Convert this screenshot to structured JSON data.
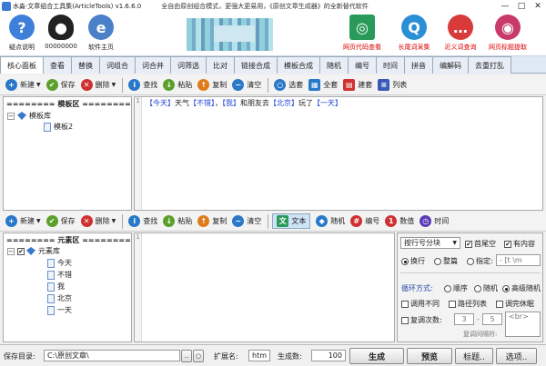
{
  "window": {
    "title": "水淼·文章组合工具集(ArticleTools) v1.6.6.0",
    "tagline": "全自由原创组合模式，更强大更易用，《原创文章生成器》的全新替代软件",
    "controls": [
      "—",
      "□",
      "✕"
    ]
  },
  "banner": {
    "left_buttons": [
      {
        "label": "疑点说明",
        "icon": "question-icon",
        "glyph": "?",
        "color": "#3d7fd9"
      },
      {
        "label": "00000000",
        "icon": "qq-penguin-icon",
        "glyph": "●",
        "color": "#222222"
      },
      {
        "label": "软件主页",
        "icon": "globe-icon",
        "glyph": "e",
        "color": "#4a80c8"
      }
    ],
    "right_buttons": [
      {
        "label": "网页代码查看",
        "icon": "web-source-icon",
        "glyph": "◎",
        "color": "#2a9a5a"
      },
      {
        "label": "长尾词采集",
        "icon": "search-icon",
        "glyph": "Q",
        "color": "#2b8fd6"
      },
      {
        "label": "近义词查询",
        "icon": "chat-bubble-icon",
        "glyph": "…",
        "color": "#d83a3a"
      },
      {
        "label": "网页标题提取",
        "icon": "web-title-icon",
        "glyph": "◉",
        "color": "#c83a6a"
      }
    ]
  },
  "tabs": [
    "核心面板",
    "查看",
    "替换",
    "词组合",
    "词合并",
    "词筛选",
    "比对",
    "链接合成",
    "模板合成",
    "随机",
    "编号",
    "时间",
    "拼音",
    "编解码",
    "去重打乱"
  ],
  "toolbar_top": {
    "left": [
      {
        "label": "新建",
        "icon": "plus-icon",
        "glyph": "+",
        "color": "#2a78c8",
        "dropdown": true
      },
      {
        "label": "保存",
        "icon": "check-icon",
        "glyph": "✔",
        "color": "#5aa02c",
        "dropdown": false
      },
      {
        "label": "删除",
        "icon": "delete-icon",
        "glyph": "✕",
        "color": "#d03030",
        "dropdown": true
      }
    ],
    "mid": [
      {
        "label": "查找",
        "icon": "info-icon",
        "glyph": "i",
        "color": "#2a78c8"
      },
      {
        "label": "粘贴",
        "icon": "paste-icon",
        "glyph": "↓",
        "color": "#5aa02c"
      },
      {
        "label": "复制",
        "icon": "copy-icon",
        "glyph": "↑",
        "color": "#e07b1a"
      },
      {
        "label": "清空",
        "icon": "clear-icon",
        "glyph": "−",
        "color": "#2a78c8"
      }
    ],
    "right": [
      {
        "label": "选套",
        "icon": "select-set-icon",
        "glyph": "○",
        "color": "#2a78c8"
      },
      {
        "label": "全套",
        "icon": "all-set-icon",
        "glyph": "▦",
        "color": "#2a78c8"
      },
      {
        "label": "建套",
        "icon": "build-set-icon",
        "glyph": "▤",
        "color": "#d03030"
      },
      {
        "label": "列表",
        "icon": "list-icon",
        "glyph": "≡",
        "color": "#3a5ab8"
      }
    ]
  },
  "template_tree": {
    "header": "======== 模板区 ========",
    "root": "模板库",
    "children": [
      "模板2"
    ]
  },
  "template_editor": {
    "line_no": "1",
    "segments": [
      {
        "t": "【今天】",
        "c": "#2346d6"
      },
      {
        "t": "天气",
        "c": "#222222"
      },
      {
        "t": "【不错】",
        "c": "#2346d6"
      },
      {
        "t": "，",
        "c": "#222222"
      },
      {
        "t": "【我】",
        "c": "#2346d6"
      },
      {
        "t": "和朋友去",
        "c": "#222222"
      },
      {
        "t": "【北京】",
        "c": "#2346d6"
      },
      {
        "t": "玩了",
        "c": "#222222"
      },
      {
        "t": "【一天】",
        "c": "#2346d6"
      }
    ]
  },
  "toolbar_bottom": {
    "left": [
      {
        "label": "新建",
        "icon": "plus-icon",
        "glyph": "+",
        "color": "#2a78c8",
        "dropdown": true
      },
      {
        "label": "保存",
        "icon": "check-icon",
        "glyph": "✔",
        "color": "#5aa02c",
        "dropdown": false
      },
      {
        "label": "删除",
        "icon": "delete-icon",
        "glyph": "✕",
        "color": "#d03030",
        "dropdown": true
      }
    ],
    "mid": [
      {
        "label": "查找",
        "icon": "info-icon",
        "glyph": "i",
        "color": "#2a78c8"
      },
      {
        "label": "粘贴",
        "icon": "paste-icon",
        "glyph": "↓",
        "color": "#5aa02c"
      },
      {
        "label": "复制",
        "icon": "copy-icon",
        "glyph": "↑",
        "color": "#e07b1a"
      },
      {
        "label": "清空",
        "icon": "clear-icon",
        "glyph": "−",
        "color": "#2a78c8"
      }
    ],
    "right": [
      {
        "label": "文本",
        "icon": "text-icon",
        "glyph": "文",
        "color": "#2a9a5a",
        "active": true
      },
      {
        "label": "随机",
        "icon": "random-icon",
        "glyph": "◆",
        "color": "#2a78c8",
        "active": false
      },
      {
        "label": "编号",
        "icon": "number-icon",
        "glyph": "#",
        "color": "#d03030",
        "active": false
      },
      {
        "label": "数值",
        "icon": "value-icon",
        "glyph": "1",
        "color": "#d03030",
        "active": false
      },
      {
        "label": "时间",
        "icon": "clock-icon",
        "glyph": "◷",
        "color": "#5a3ab8",
        "active": false
      }
    ]
  },
  "element_tree": {
    "header": "======== 元素区 ========",
    "root": "元素库",
    "children": [
      "今天",
      "不错",
      "我",
      "北京",
      "一天"
    ]
  },
  "element_editor": {
    "line_no": "1"
  },
  "options": {
    "split_mode": "按行号分块",
    "chk_trim": "首尾空",
    "chk_has_content": "有内容",
    "radio_wrap": "换行",
    "radio_whole": "整篇",
    "radio_custom": "指定:",
    "custom_value": "- [t \\m",
    "loop_label": "循环方式:",
    "loop_seq": "顺序",
    "loop_random": "随机",
    "loop_hq": "高级随机",
    "chk_diff": "调用不同",
    "chk_path": "路径列表",
    "chk_fill": "调完休眠",
    "chk_repeat": "复调次数:",
    "repeat_from": "3",
    "repeat_to": "5",
    "repeat_sep": "-",
    "br_value": "<br>",
    "sep_label": "复调间隔符:"
  },
  "bottom": {
    "save_dir_label": "保存目录:",
    "save_dir_value": "C:\\原创文章\\",
    "browse_btn": "..",
    "open_btn": "○",
    "ext_label": "扩展名:",
    "ext_value": "htm",
    "count_label": "生成数:",
    "count_value": "100",
    "generate_btn": "生成",
    "preview_btn": "预览",
    "title_btn": "标题..",
    "options_btn": "选项.."
  }
}
